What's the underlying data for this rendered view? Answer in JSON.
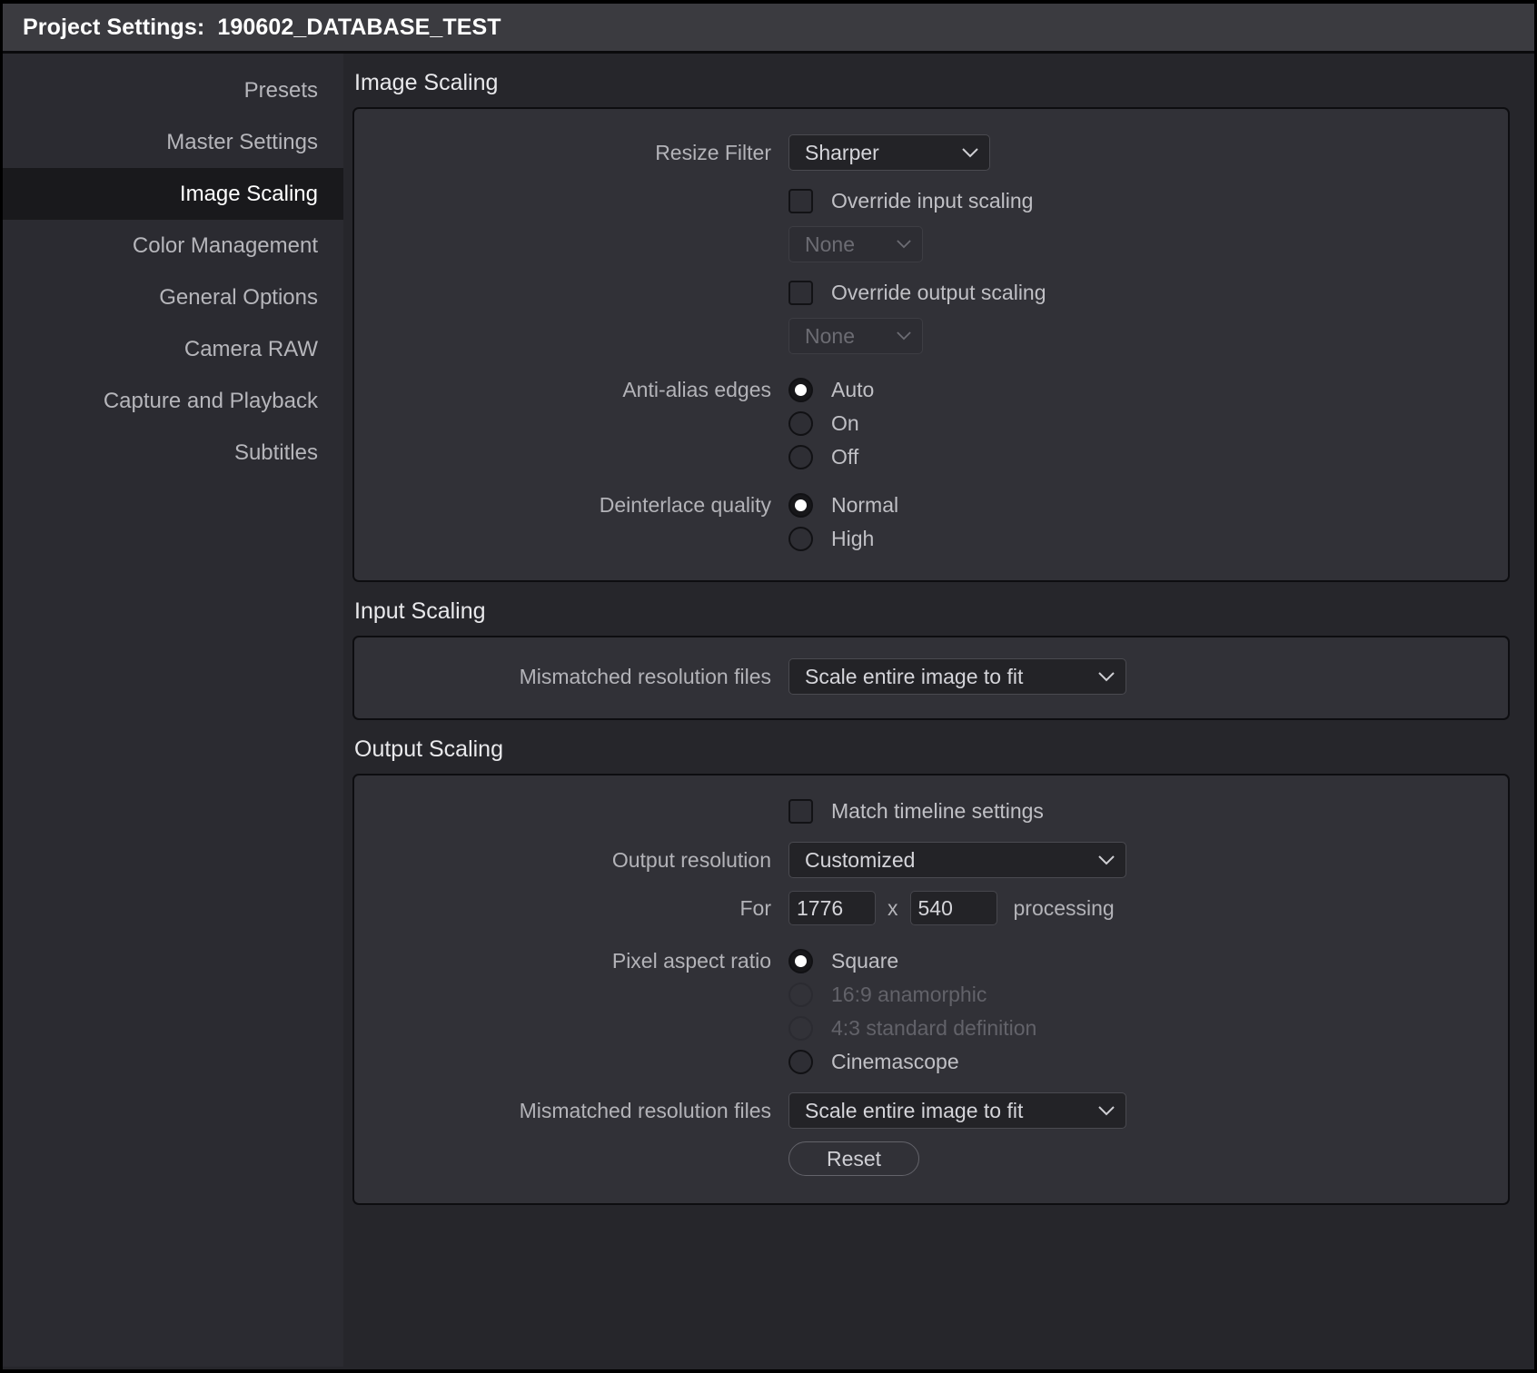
{
  "titlebar": {
    "label": "Project Settings:",
    "project_name": "190602_DATABASE_TEST"
  },
  "sidebar": {
    "items": [
      {
        "label": "Presets",
        "active": false
      },
      {
        "label": "Master Settings",
        "active": false
      },
      {
        "label": "Image Scaling",
        "active": true
      },
      {
        "label": "Color Management",
        "active": false
      },
      {
        "label": "General Options",
        "active": false
      },
      {
        "label": "Camera RAW",
        "active": false
      },
      {
        "label": "Capture and Playback",
        "active": false
      },
      {
        "label": "Subtitles",
        "active": false
      }
    ]
  },
  "image_scaling": {
    "heading": "Image Scaling",
    "resize_filter": {
      "label": "Resize Filter",
      "value": "Sharper"
    },
    "override_input": {
      "label": "Override input scaling",
      "checked": false,
      "dropdown_value": "None",
      "dropdown_disabled": true
    },
    "override_output": {
      "label": "Override output scaling",
      "checked": false,
      "dropdown_value": "None",
      "dropdown_disabled": true
    },
    "anti_alias": {
      "label": "Anti-alias edges",
      "options": [
        {
          "label": "Auto",
          "selected": true,
          "disabled": false
        },
        {
          "label": "On",
          "selected": false,
          "disabled": false
        },
        {
          "label": "Off",
          "selected": false,
          "disabled": false
        }
      ]
    },
    "deinterlace": {
      "label": "Deinterlace quality",
      "options": [
        {
          "label": "Normal",
          "selected": true,
          "disabled": false
        },
        {
          "label": "High",
          "selected": false,
          "disabled": false
        }
      ]
    }
  },
  "input_scaling": {
    "heading": "Input Scaling",
    "mismatched": {
      "label": "Mismatched resolution files",
      "value": "Scale entire image to fit"
    }
  },
  "output_scaling": {
    "heading": "Output Scaling",
    "match_timeline": {
      "label": "Match timeline settings",
      "checked": false
    },
    "output_resolution": {
      "label": "Output resolution",
      "value": "Customized"
    },
    "for_processing": {
      "prefix": "For",
      "width": "1776",
      "separator": "x",
      "height": "540",
      "suffix": "processing"
    },
    "pixel_aspect_ratio": {
      "label": "Pixel aspect ratio",
      "options": [
        {
          "label": "Square",
          "selected": true,
          "disabled": false
        },
        {
          "label": "16:9 anamorphic",
          "selected": false,
          "disabled": true
        },
        {
          "label": "4:3 standard definition",
          "selected": false,
          "disabled": true
        },
        {
          "label": "Cinemascope",
          "selected": false,
          "disabled": false
        }
      ]
    },
    "mismatched": {
      "label": "Mismatched resolution files",
      "value": "Scale entire image to fit"
    },
    "reset_label": "Reset"
  },
  "colors": {
    "titlebar_bg": "#3b3b40",
    "page_bg": "#26262b",
    "sidebar_bg": "#2b2b31",
    "sidebar_active_bg": "#19191c",
    "panel_bg": "#313137",
    "control_bg": "#232327",
    "text_primary": "#e9e9ec",
    "text_secondary": "#b3b3b8",
    "text_disabled": "#6c6c73"
  }
}
